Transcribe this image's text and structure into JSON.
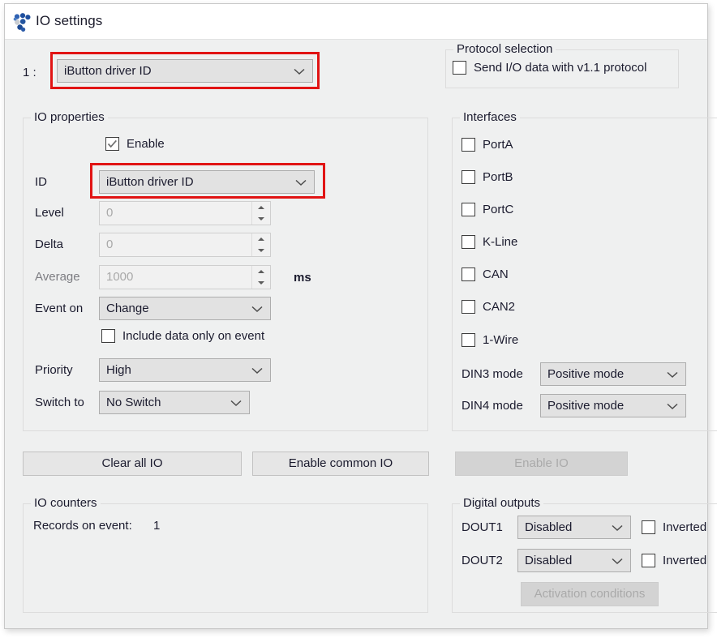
{
  "window": {
    "title": "IO settings",
    "icon": "dots-cluster-icon"
  },
  "top_selector": {
    "index_label": "1 :",
    "value": "iButton driver ID"
  },
  "protocol_selection": {
    "title": "Protocol selection",
    "checkbox_label": "Send I/O data with v1.1 protocol",
    "checked": false
  },
  "io_properties": {
    "title": "IO properties",
    "enable": {
      "label": "Enable",
      "checked": true
    },
    "fields": {
      "id": {
        "label": "ID",
        "value": "iButton driver ID"
      },
      "level": {
        "label": "Level",
        "value": "0"
      },
      "delta": {
        "label": "Delta",
        "value": "0"
      },
      "average": {
        "label": "Average",
        "value": "1000",
        "unit": "ms"
      },
      "event_on": {
        "label": "Event on",
        "value": "Change"
      },
      "include_data": {
        "label": "Include data only on event",
        "checked": false
      },
      "priority": {
        "label": "Priority",
        "value": "High"
      },
      "switch_to": {
        "label": "Switch to",
        "value": "No Switch"
      }
    }
  },
  "interfaces": {
    "title": "Interfaces",
    "checkboxes": [
      {
        "label": "PortA",
        "checked": false
      },
      {
        "label": "PortB",
        "checked": false
      },
      {
        "label": "PortC",
        "checked": false
      },
      {
        "label": "K-Line",
        "checked": false
      },
      {
        "label": "CAN",
        "checked": false
      },
      {
        "label": "CAN2",
        "checked": false
      },
      {
        "label": "1-Wire",
        "checked": false
      }
    ],
    "din3": {
      "label": "DIN3 mode",
      "value": "Positive mode"
    },
    "din4": {
      "label": "DIN4 mode",
      "value": "Positive mode"
    }
  },
  "buttons": {
    "clear_all_io": "Clear all IO",
    "enable_common_io": "Enable common IO",
    "enable_io": "Enable IO"
  },
  "io_counters": {
    "title": "IO counters",
    "records_label": "Records on event:",
    "records_value": "1"
  },
  "digital_outputs": {
    "title": "Digital outputs",
    "dout1": {
      "label": "DOUT1",
      "value": "Disabled",
      "inverted_label": "Inverted",
      "inverted": false
    },
    "dout2": {
      "label": "DOUT2",
      "value": "Disabled",
      "inverted_label": "Inverted",
      "inverted": false
    },
    "activation_button": "Activation conditions"
  },
  "colors": {
    "highlight": "#e11414",
    "window_bg": "#eff0f0",
    "accent_blue": "#2c5aa0"
  }
}
